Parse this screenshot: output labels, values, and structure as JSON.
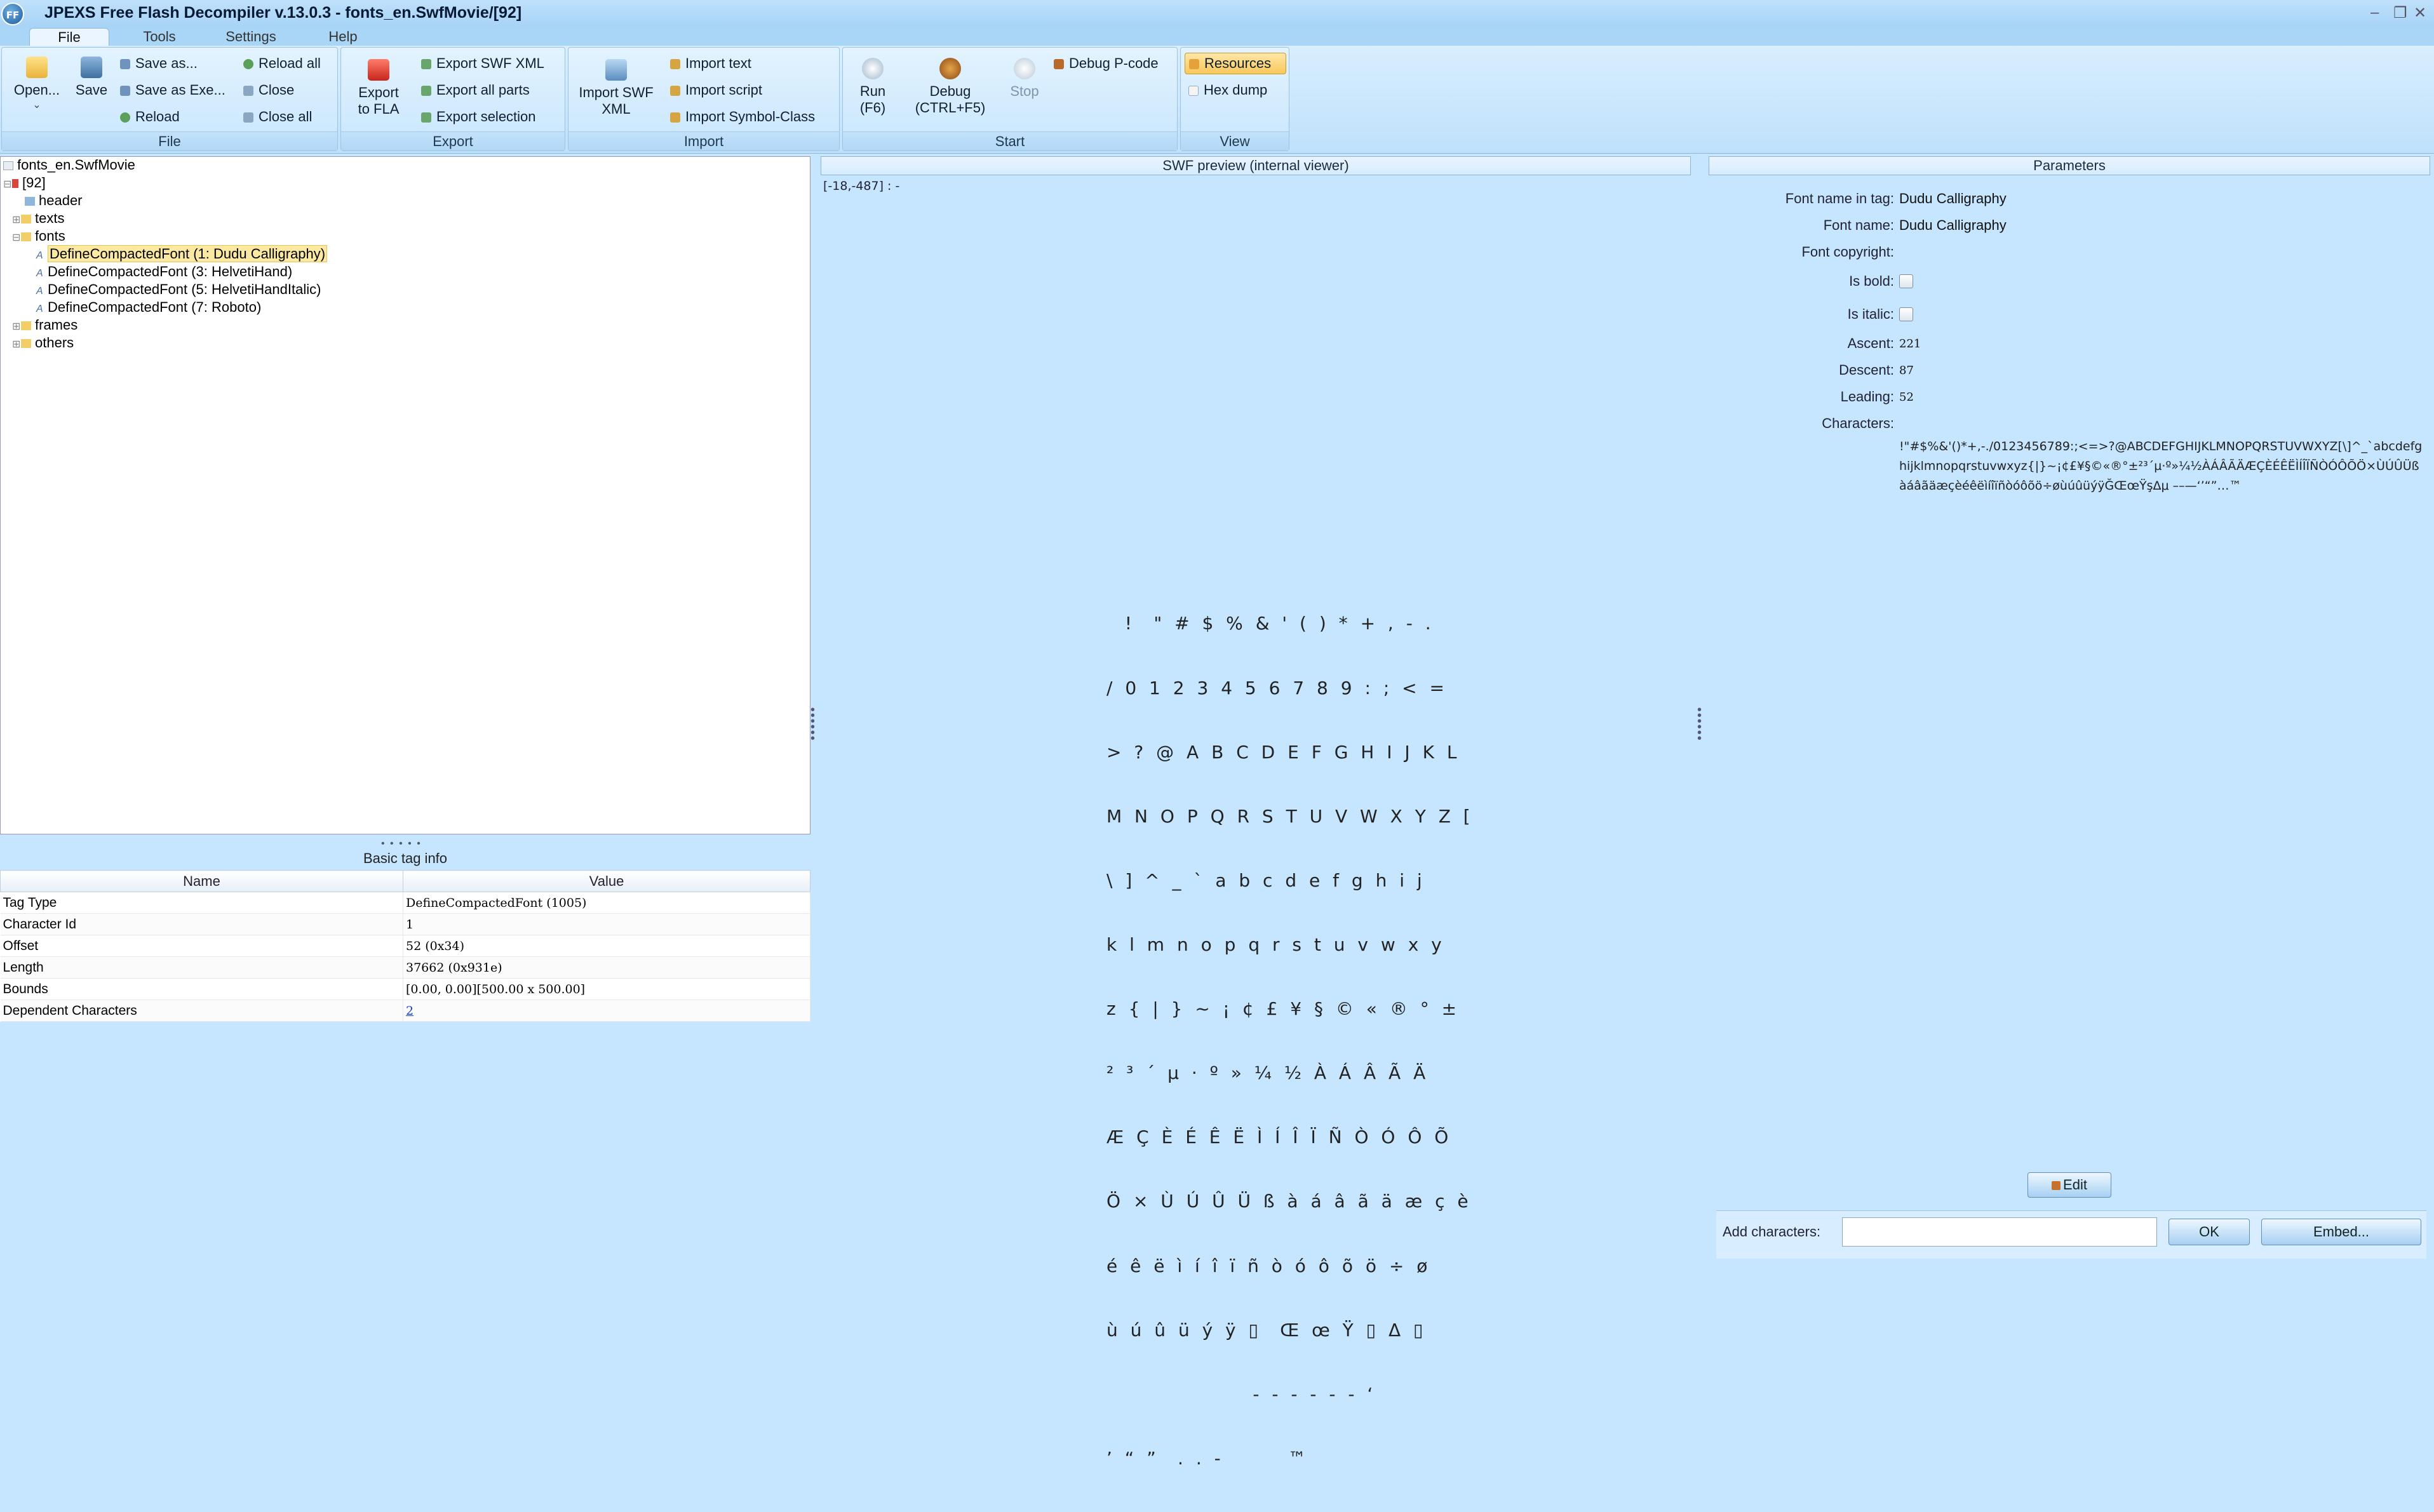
{
  "window": {
    "title": "JPEXS Free Flash Decompiler v.13.0.3 - fonts_en.SwfMovie/[92]",
    "logo_text": "FF",
    "controls": [
      "–",
      "❐",
      "✕"
    ]
  },
  "menu": {
    "tabs": [
      "File",
      "Tools",
      "Settings",
      "Help"
    ],
    "active_tab": "File"
  },
  "ribbon": {
    "groups": {
      "file": {
        "label": "File",
        "open": "Open...",
        "save": "Save",
        "save_as": "Save as...",
        "save_as_exe": "Save as Exe...",
        "reload": "Reload",
        "reload_all": "Reload all",
        "close": "Close",
        "close_all": "Close all"
      },
      "export": {
        "label": "Export",
        "export_to_fla_line1": "Export",
        "export_to_fla_line2": "to FLA",
        "export_swf_xml": "Export SWF XML",
        "export_all_parts": "Export all parts",
        "export_selection": "Export selection"
      },
      "import": {
        "label": "Import",
        "import_swf_xml_line1": "Import SWF",
        "import_swf_xml_line2": "XML",
        "import_text": "Import text",
        "import_script": "Import script",
        "import_symbol_class": "Import Symbol-Class"
      },
      "start": {
        "label": "Start",
        "run_line1": "Run",
        "run_line2": "(F6)",
        "debug_line1": "Debug",
        "debug_line2": "(CTRL+F5)",
        "stop": "Stop",
        "debug_pcode": "Debug P-code"
      },
      "view": {
        "label": "View",
        "resources": "Resources",
        "hex_dump": "Hex dump"
      }
    }
  },
  "tree": {
    "root": "fonts_en.SwfMovie",
    "movie": "[92]",
    "header": "header",
    "texts": "texts",
    "fonts": "fonts",
    "font_items": [
      "DefineCompactedFont (1: Dudu Calligraphy)",
      "DefineCompactedFont (3: HelvetiHand)",
      "DefineCompactedFont (5: HelvetiHandItalic)",
      "DefineCompactedFont (7: Roboto)"
    ],
    "frames": "frames",
    "others": "others"
  },
  "tag_info": {
    "title": "Basic tag info",
    "columns": [
      "Name",
      "Value"
    ],
    "rows": [
      {
        "name": "Tag Type",
        "value": "DefineCompactedFont (1005)"
      },
      {
        "name": "Character Id",
        "value": "1"
      },
      {
        "name": "Offset",
        "value": "52 (0x34)"
      },
      {
        "name": "Length",
        "value": "37662 (0x931e)"
      },
      {
        "name": "Bounds",
        "value": "[0.00, 0.00][500.00 x 500.00]"
      },
      {
        "name": "Dependent Characters",
        "value": "2"
      }
    ]
  },
  "preview": {
    "title": "SWF preview (internal viewer)",
    "coords": "[-18,-487] :  -",
    "glyph_rows": [
      "  !  \" # $ % & ' ( ) * + , - .",
      "/ 0 1 2 3 4 5 6 7 8 9 : ; < =",
      "> ? @ A B C D E F G H I J K L",
      "M N O P Q R S T U V W X Y Z [",
      "\\ ] ^ _ ` a b c d e f g h i j",
      "k l m n o p q r s t u v w x y",
      "z { | } ~ ¡ ¢ £ ¥ § © « ® ° ±",
      "² ³ ´ µ · º » ¼ ½ À Á Â Ã Ä",
      "Æ Ç È É Ê Ë Ì Í Î Ï Ñ Ò Ó Ô Õ",
      "Ö × Ù Ú Û Ü ß à á â ã ä æ ç è",
      "é ê ë ì í î ï ñ ò ó ô õ ö ÷ ø",
      "ù ú û ü ý ÿ ▯  Œ œ Ÿ ▯ Δ ▯",
      "                - - - - - - ‘",
      "’ “ ”  . . -       ™"
    ]
  },
  "parameters": {
    "title": "Parameters",
    "font_name_in_tag_label": "Font name in tag:",
    "font_name_in_tag": "Dudu Calligraphy",
    "font_name_label": "Font name:",
    "font_name": "Dudu Calligraphy",
    "font_copyright_label": "Font copyright:",
    "font_copyright": "",
    "is_bold_label": "Is bold:",
    "is_bold": false,
    "is_italic_label": "Is italic:",
    "is_italic": false,
    "ascent_label": "Ascent:",
    "ascent": "221",
    "descent_label": "Descent:",
    "descent": "87",
    "leading_label": "Leading:",
    "leading": "52",
    "characters_label": "Characters:",
    "characters": "!\"#$%&'()*+,-./0123456789:;<=>?@ABCDEFGHIJKLMNOPQRSTUVWXYZ[\\]^_`abcdefghijklmnopqrstuvwxyz{|}~¡¢£¥§©«®°±²³´µ·º»¼½ÀÁÂÃÄÆÇÈÉÊËÌÍÎÏÑÒÓÔÕÖ×ÙÚÛÜßàáâãäæçèéêëìíîïñòóôõö÷øùúûüýÿĞŒœŸşΔμ ––—‘’“”…™",
    "edit_button": "Edit",
    "add_characters_label": "Add characters:",
    "add_characters_value": "",
    "ok_button": "OK",
    "embed_button": "Embed..."
  }
}
